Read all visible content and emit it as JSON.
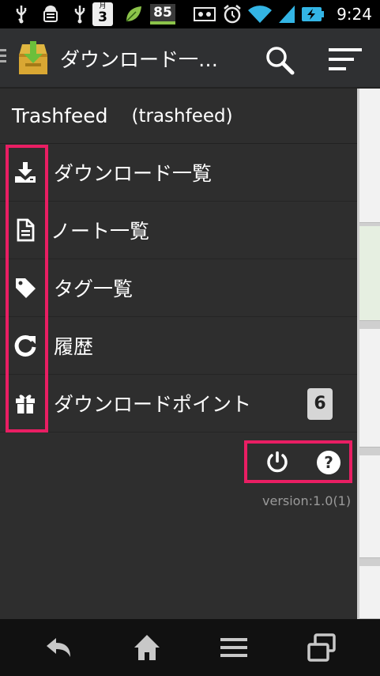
{
  "status_bar": {
    "icons": [
      "usb-icon",
      "android-debug-icon",
      "usb-icon",
      "calendar-icon",
      "leaf-icon",
      "battery-level-icon",
      "voicemail-icon",
      "alarm-icon",
      "wifi-icon",
      "signal-icon",
      "battery-charging-icon"
    ],
    "calendar_month": "月",
    "calendar_day": "3",
    "battery_level": "85",
    "time": "9:24"
  },
  "action_bar": {
    "title": "ダウンロード一…",
    "logo": "app-logo-download-box",
    "actions": [
      "search-icon",
      "overflow-menu-icon"
    ]
  },
  "drawer": {
    "user_name": "Trashfeed",
    "account_id": "(trashfeed)",
    "items": [
      {
        "label": "ダウンロード一覧",
        "icon": "download-icon"
      },
      {
        "label": "ノート一覧",
        "icon": "document-icon"
      },
      {
        "label": "タグ一覧",
        "icon": "tag-icon"
      },
      {
        "label": "履歴",
        "icon": "refresh-icon"
      },
      {
        "label": "ダウンロードポイント",
        "icon": "gift-icon",
        "badge": "6"
      }
    ],
    "footer": {
      "actions": [
        "power-icon",
        "help-icon"
      ],
      "version": "version:1.0(1)"
    }
  },
  "nav_bar": {
    "buttons": [
      "back-icon",
      "home-icon",
      "menu-icon",
      "recent-apps-icon"
    ]
  },
  "colors": {
    "drawer_bg": "#2e2e2e",
    "action_bar_bg": "#2f3032",
    "highlight": "#e91e63"
  }
}
